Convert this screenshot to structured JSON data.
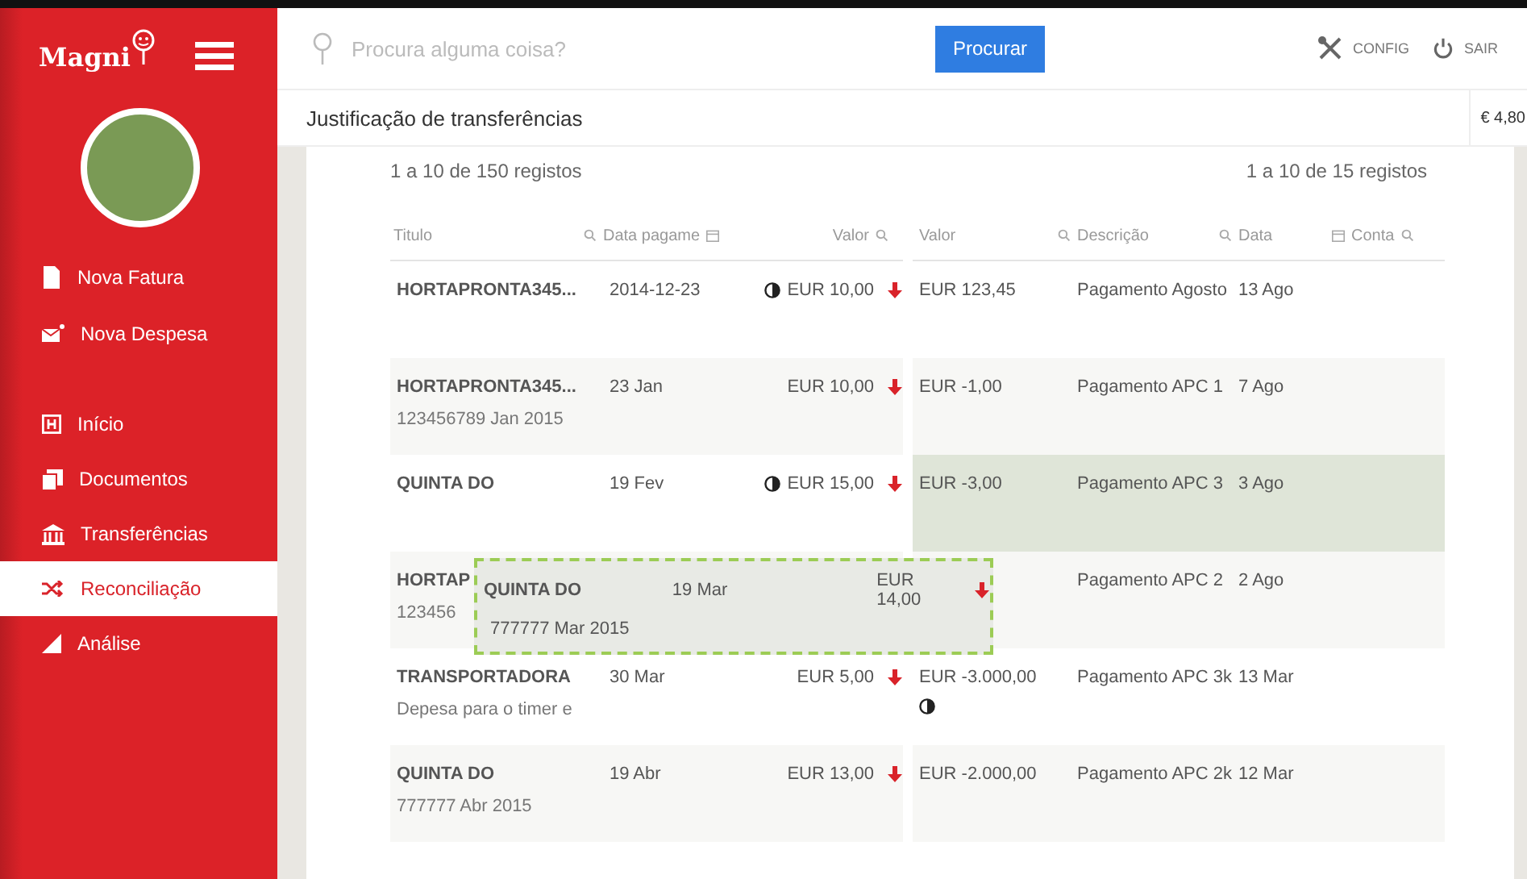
{
  "sidebar": {
    "logo": "Magni",
    "actions": [
      {
        "label": "Nova Fatura"
      },
      {
        "label": "Nova Despesa"
      }
    ],
    "items": [
      {
        "label": "Início",
        "selected": false
      },
      {
        "label": "Documentos",
        "selected": false
      },
      {
        "label": "Transferências",
        "selected": false
      },
      {
        "label": "Reconciliação",
        "selected": true
      },
      {
        "label": "Análise",
        "selected": false
      }
    ]
  },
  "search": {
    "placeholder": "Procura alguma coisa?",
    "button": "Procurar"
  },
  "header_actions": [
    {
      "label": "CONFIG"
    },
    {
      "label": "SAIR"
    }
  ],
  "page_title": "Justificação de transferências",
  "balance": "€ 4,80",
  "left_table": {
    "count": "1 a 10 de 150 registos",
    "columns": [
      {
        "label": "Titulo"
      },
      {
        "label": "Data pagame"
      },
      {
        "label": "Valor"
      }
    ],
    "rows": [
      {
        "title": "HORTAPRONTA345...",
        "date": "2014-12-23",
        "amount": "EUR 10,00",
        "half_icon": true
      },
      {
        "title": "HORTAPRONTA345...",
        "subtitle": "123456789 Jan 2015",
        "date": "23 Jan",
        "amount": "EUR 10,00",
        "half_icon": false
      },
      {
        "title": "QUINTA DO",
        "date": "19 Fev",
        "amount": "EUR 15,00",
        "half_icon": true
      },
      {
        "title": "HORTAP",
        "subtitle": "123456"
      },
      {
        "title": "TRANSPORTADORA",
        "subtitle": "Depesa para o timer e",
        "date": "30 Mar",
        "amount": "EUR 5,00",
        "half_icon": false
      },
      {
        "title": "QUINTA DO",
        "subtitle": "777777 Abr 2015",
        "date": "19 Abr",
        "amount": "EUR 13,00",
        "half_icon": false
      }
    ]
  },
  "right_table": {
    "count": "1 a 10 de 15 registos",
    "columns": [
      {
        "label": "Valor"
      },
      {
        "label": "Descrição"
      },
      {
        "label": "Data"
      },
      {
        "label": "Conta"
      }
    ],
    "rows": [
      {
        "amount": "EUR 123,45",
        "description": "Pagamento Agosto",
        "date": "13 Ago",
        "half_icon": false,
        "highlighted": false
      },
      {
        "amount": "EUR -1,00",
        "description": "Pagamento APC 1",
        "date": "7 Ago",
        "half_icon": false,
        "highlighted": false
      },
      {
        "amount": "EUR -3,00",
        "description": "Pagamento APC 3",
        "date": "3 Ago",
        "half_icon": false,
        "highlighted": true
      },
      {
        "description": "Pagamento APC 2",
        "date": "2 Ago",
        "half_icon": false,
        "highlighted": false
      },
      {
        "amount": "EUR -3.000,00",
        "description": "Pagamento APC 3k",
        "date": "13 Mar",
        "half_icon": true,
        "highlighted": false
      },
      {
        "amount": "EUR -2.000,00",
        "description": "Pagamento APC 2k",
        "date": "12 Mar",
        "half_icon": false,
        "highlighted": false
      }
    ]
  },
  "dragged_row": {
    "title": "QUINTA DO",
    "subtitle": "777777 Mar 2015",
    "date": "19 Mar",
    "amount": "EUR 14,00"
  }
}
